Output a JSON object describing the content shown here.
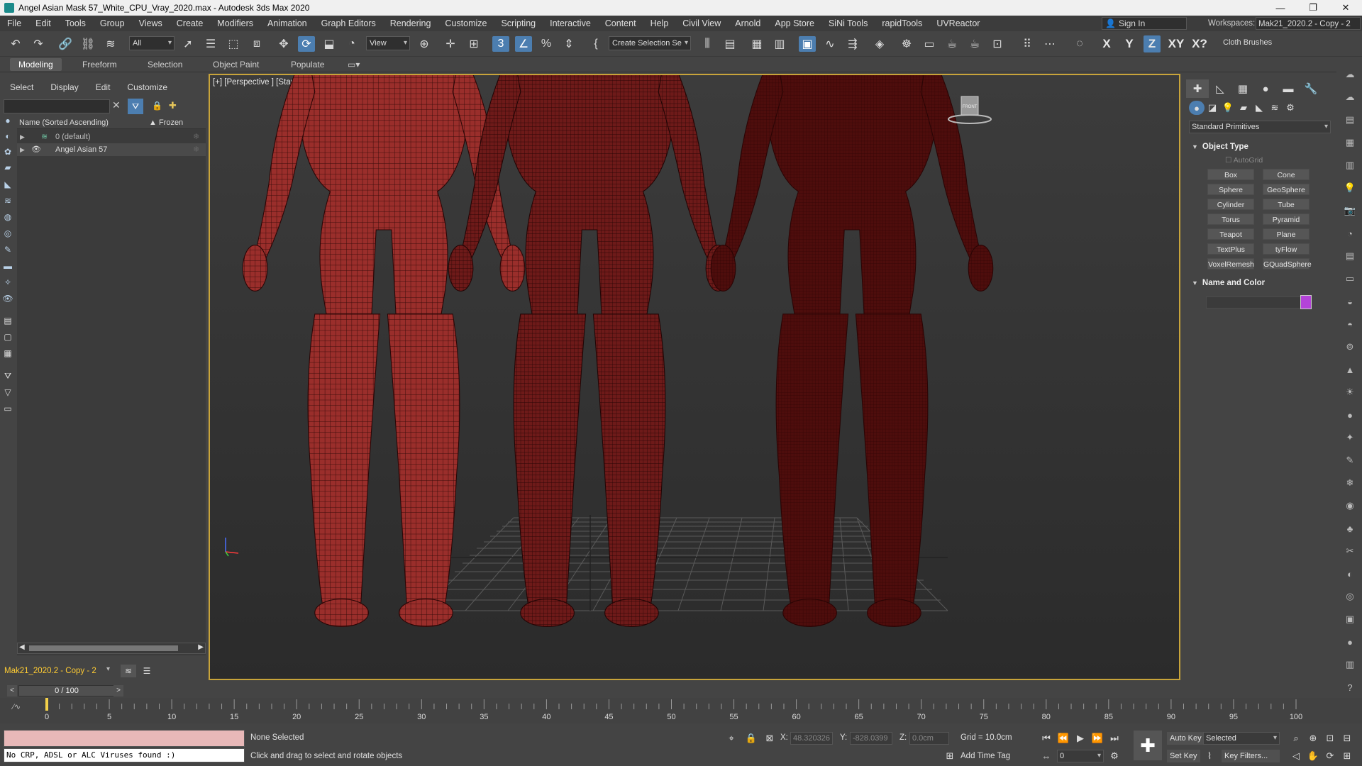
{
  "window": {
    "title": "Angel Asian Mask 57_White_CPU_Vray_2020.max - Autodesk 3ds Max 2020",
    "minimize": "—",
    "maximize": "❐",
    "close": "✕"
  },
  "menu": {
    "items": [
      "File",
      "Edit",
      "Tools",
      "Group",
      "Views",
      "Create",
      "Modifiers",
      "Animation",
      "Graph Editors",
      "Rendering",
      "Customize",
      "Scripting",
      "Interactive",
      "Content",
      "Help",
      "Civil View",
      "Arnold",
      "App Store",
      "SiNi Tools",
      "rapidTools",
      "UVReactor"
    ],
    "sign_in": "Sign In",
    "workspaces_label": "Workspaces:",
    "workspaces_value": "Mak21_2020.2 - Copy - 2"
  },
  "toolbar": {
    "selection_filter": "All",
    "ref_coord": "View",
    "named_selection": "Create Selection Se",
    "axis_x": "X",
    "axis_y": "Y",
    "axis_z": "Z",
    "axis_xy": "XY",
    "axis_xq": "X?",
    "cloth_brushes": "Cloth Brushes"
  },
  "ribbon": {
    "tabs": [
      "Modeling",
      "Freeform",
      "Selection",
      "Object Paint",
      "Populate"
    ],
    "active": "Modeling"
  },
  "scene_explorer": {
    "menu": [
      "Select",
      "Display",
      "Edit",
      "Customize"
    ],
    "column_name": "Name (Sorted Ascending)",
    "column_frozen": "▲ Frozen",
    "rows": [
      {
        "name": "0 (default)",
        "type": "layer"
      },
      {
        "name": "Angel Asian 57",
        "type": "object"
      }
    ],
    "layer_selector": "Mak21_2020.2 - Copy - 2"
  },
  "viewport": {
    "label": "[+] [Perspective ] [Standard ] [Clay + Edged Faces ]",
    "viewcube_label": "FRONT"
  },
  "command_panel": {
    "primitives_dropdown": "Standard Primitives",
    "object_type_title": "Object Type",
    "autogrid": "AutoGrid",
    "buttons": [
      "Box",
      "Cone",
      "Sphere",
      "GeoSphere",
      "Cylinder",
      "Tube",
      "Torus",
      "Pyramid",
      "Teapot",
      "Plane",
      "TextPlus",
      "tyFlow",
      "VoxelRemesh",
      "GQuadSphere"
    ],
    "name_color_title": "Name and Color",
    "color": "#b443d8"
  },
  "timeline": {
    "slider_value": "0 / 100",
    "prev": "<",
    "next": ">",
    "ticks": [
      0,
      5,
      10,
      15,
      20,
      25,
      30,
      35,
      40,
      45,
      50,
      55,
      60,
      65,
      70,
      75,
      80,
      85,
      90,
      95,
      100
    ]
  },
  "status": {
    "maxscript_output": "No CRP, ADSL or ALC Viruses found :)",
    "selection": "None Selected",
    "prompt": "Click and drag to select and rotate objects",
    "x_label": "X:",
    "x_value": "48.320326",
    "y_label": "Y:",
    "y_value": "-828.0399",
    "z_label": "Z:",
    "z_value": "0.0cm",
    "grid": "Grid = 10.0cm",
    "add_time_tag": "Add Time Tag",
    "auto_key": "Auto Key",
    "set_key": "Set Key",
    "selected_dropdown": "Selected",
    "key_filters": "Key Filters...",
    "frame_field": "0"
  },
  "colors": {
    "viewport_border": "#c8a43a",
    "active_accent": "#4c7eb0",
    "model_red": "#8a2626"
  }
}
